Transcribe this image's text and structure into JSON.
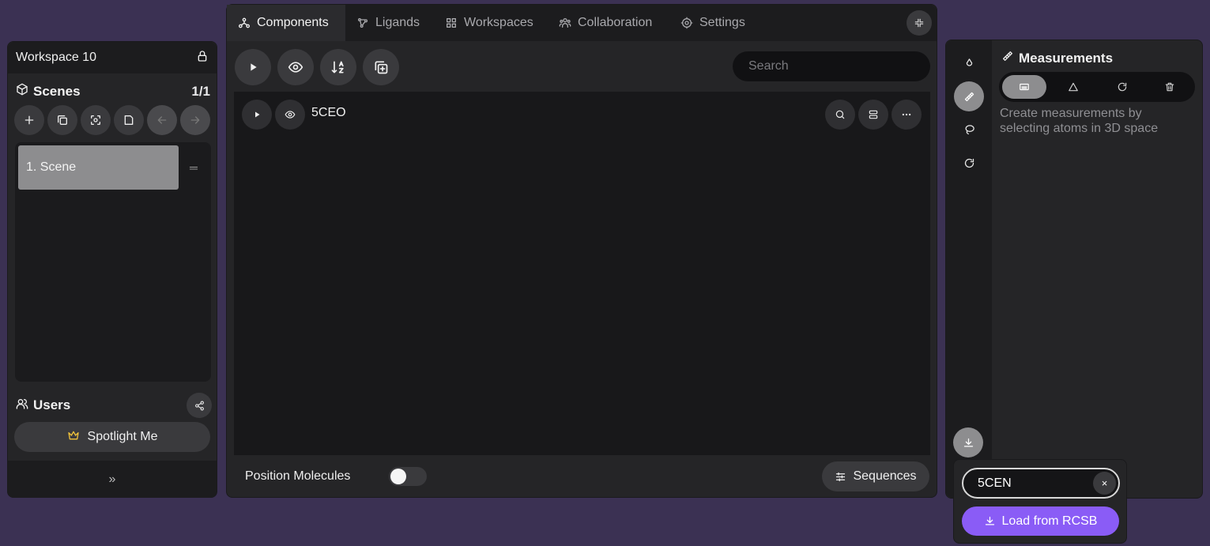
{
  "colors": {
    "background": "#3b3153",
    "panel": "#252527",
    "accent": "#8a5cf6",
    "crown": "#f0c23b"
  },
  "left": {
    "workspace_title": "Workspace 10",
    "scenes_title": "Scenes",
    "scenes_count": "1/1",
    "scenes": [
      {
        "label": "1. Scene"
      }
    ],
    "users_title": "Users",
    "spotlight_label": "Spotlight Me",
    "footer_icon": "»"
  },
  "tabs": [
    {
      "label": "Components",
      "icon": "components-icon",
      "active": true
    },
    {
      "label": "Ligands",
      "icon": "ligand-icon"
    },
    {
      "label": "Workspaces",
      "icon": "grid-icon"
    },
    {
      "label": "Collaboration",
      "icon": "users-icon"
    },
    {
      "label": "Settings",
      "icon": "gear-icon"
    }
  ],
  "mid": {
    "search_placeholder": "Search",
    "component_name": "5CEO",
    "position_label": "Position Molecules",
    "position_enabled": false,
    "sequences_label": "Sequences"
  },
  "right": {
    "measurements_title": "Measurements",
    "measurements_desc": "Create measurements by selecting atoms in 3D space"
  },
  "download": {
    "pdb_value": "5CEN",
    "clear_label": "×",
    "load_label": "Load from RCSB"
  }
}
